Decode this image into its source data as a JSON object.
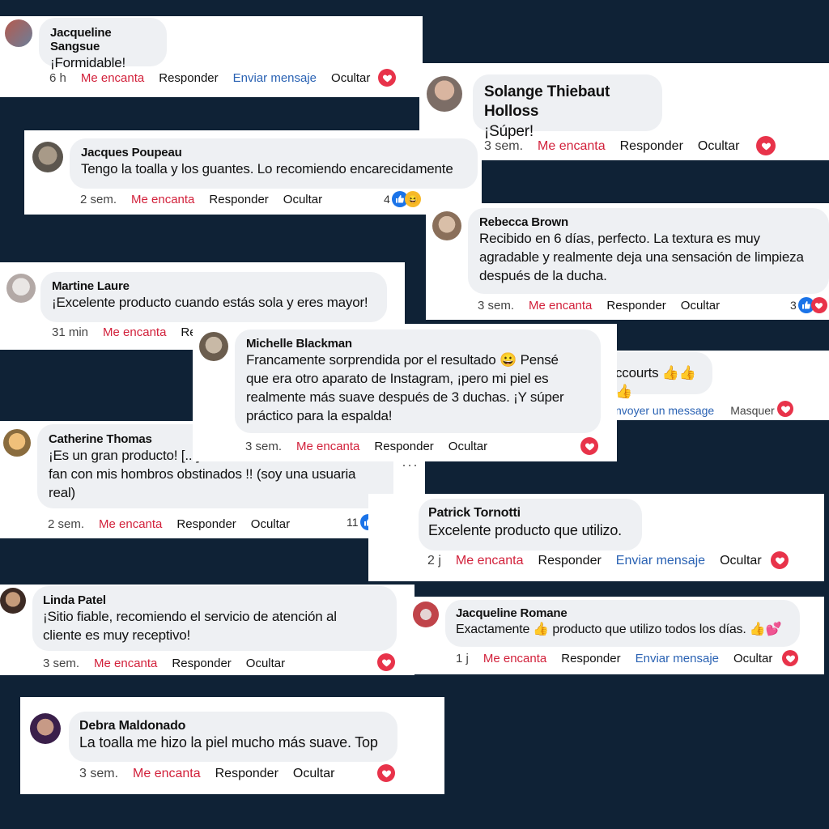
{
  "colors": {
    "background": "#0f2236",
    "love": "#d2213b",
    "link": "#2a62b3",
    "heart": "#e8334a",
    "like": "#1a73e8"
  },
  "comments": [
    {
      "name": "Jacqueline Sangsue",
      "text": "¡Formidable!",
      "time": "6 h",
      "love": "Me encanta",
      "reply": "Responder",
      "message": "Enviar mensaje",
      "hide": "Ocultar"
    },
    {
      "name": "Solange Thiebaut Holloss",
      "text": "¡Súper!",
      "time": "3 sem.",
      "love": "Me encanta",
      "reply": "Responder",
      "hide": "Ocultar"
    },
    {
      "name": "Jacques Poupeau",
      "text": "Tengo la toalla y los guantes. Lo recomiendo encarecidamente",
      "time": "2 sem.",
      "love": "Me encanta",
      "reply": "Responder",
      "hide": "Ocultar",
      "reactions": "4"
    },
    {
      "name": "Rebecca Brown",
      "text": "Recibido en 6 días, perfecto. La textura es muy agradable y realmente deja una sensación de limpieza después de la ducha.",
      "time": "3 sem.",
      "love": "Me encanta",
      "reply": "Responder",
      "hide": "Ocultar",
      "reactions": "3"
    },
    {
      "name": "Martine Laure",
      "text": "¡Excelente producto cuando estás sola y eres mayor!",
      "time": "31 min",
      "love": "Me encanta",
      "reply": "Re"
    },
    {
      "name": "Michelle Blackman",
      "text": "Francamente sorprendida por el resultado 😀 Pensé que era otro aparato de Instagram, ¡pero mi piel es realmente más suave después de 3 duchas. ¡Y súper práctico para la espalda!",
      "time": "3 sem.",
      "love": "Me encanta",
      "reply": "Responder",
      "hide": "Ocultar"
    },
    {
      "text": "ccourts 👍👍👍",
      "message": "nvoyer un message",
      "hide": "Masquer"
    },
    {
      "name": "Catherine Thomas",
      "text": "¡Es un gran producto! [...] fan con mis hombros obstinados !! (soy una usuaria real)",
      "time": "2 sem.",
      "love": "Me encanta",
      "reply": "Responder",
      "hide": "Ocultar",
      "reactions": "11"
    },
    {
      "name": "Patrick Tornotti",
      "text": "Excelente producto que utilizo.",
      "time": "2 j",
      "love": "Me encanta",
      "reply": "Responder",
      "message": "Enviar mensaje",
      "hide": "Ocultar"
    },
    {
      "name": "Linda Patel",
      "text": "¡Sitio fiable, recomiendo el servicio de atención al cliente es muy receptivo!",
      "time": "3 sem.",
      "love": "Me encanta",
      "reply": "Responder",
      "hide": "Ocultar"
    },
    {
      "name": "Jacqueline Romane",
      "text": "Exactamente 👍 producto que utilizo todos los días. 👍💕",
      "time": "1 j",
      "love": "Me encanta",
      "reply": "Responder",
      "message": "Enviar mensaje",
      "hide": "Ocultar"
    },
    {
      "name": "Debra Maldonado",
      "text": "La toalla me hizo la piel mucho más suave. Top",
      "time": "3 sem.",
      "love": "Me encanta",
      "reply": "Responder",
      "hide": "Ocultar"
    }
  ],
  "catherine_lines": [
    "¡Es un gran producto! [...]",
    "fan con mis hombros obstinados !! (soy una usuaria",
    "real)"
  ],
  "michelle_lines": [
    "Francamente sorprendida por el resultado 😀 Pensé",
    "que era otro aparato de Instagram, ¡pero mi piel es",
    "realmente más suave después de 3 duchas. ¡Y súper",
    "práctico para la espalda!"
  ],
  "rebecca_lines": [
    "Recibido en 6 días, perfecto. La textura es muy",
    "agradable y realmente deja una sensación de limpieza",
    "después de la ducha."
  ],
  "linda_lines": [
    "¡Sitio fiable, recomiendo el servicio de atención al",
    "cliente es muy receptivo!"
  ]
}
